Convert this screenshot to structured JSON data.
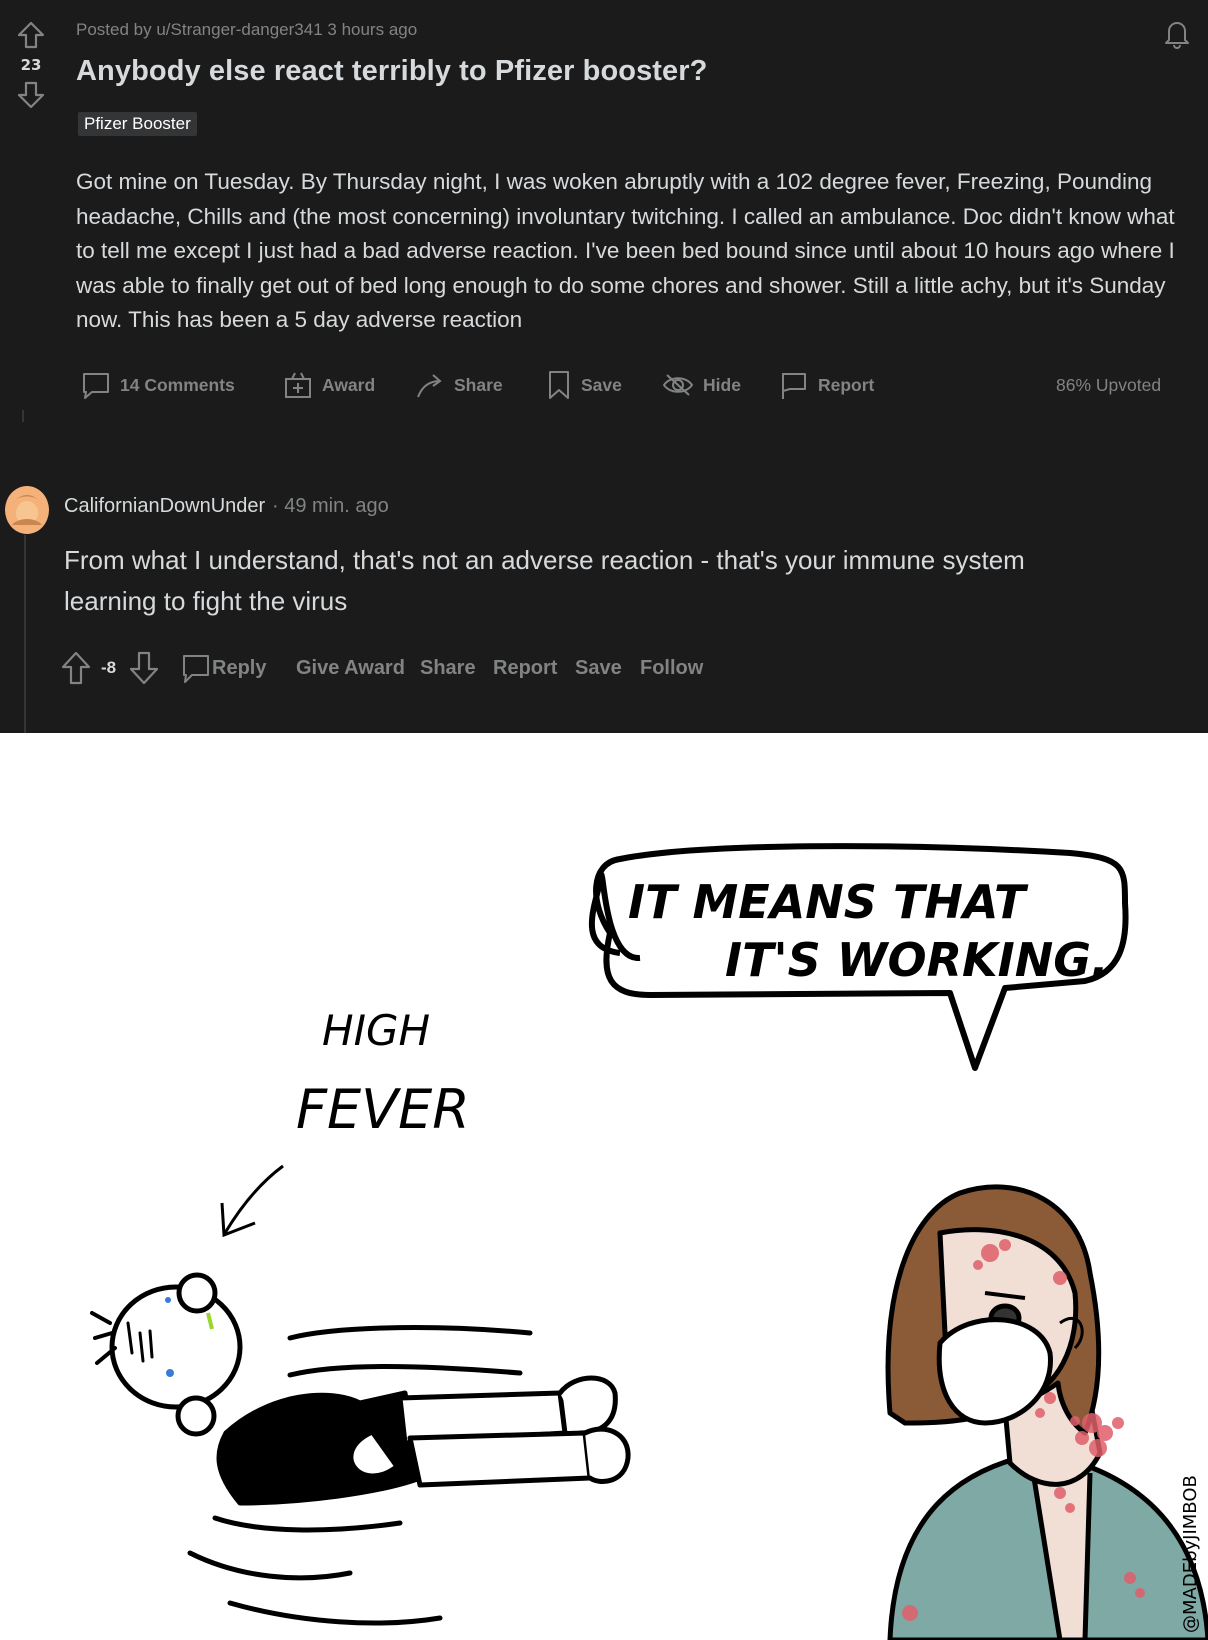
{
  "post": {
    "score": "23",
    "meta": "Posted by u/Stranger-danger341 3 hours ago",
    "title": "Anybody else react terribly to Pfizer booster?",
    "flair": "Pfizer Booster",
    "body": "Got mine on Tuesday. By Thursday night, I was woken abruptly with a 102 degree fever, Freezing, Pounding headache, Chills and (the most concerning) involuntary twitching. I called an ambulance. Doc didn't know what to tell me except I just had a bad adverse reaction. I've been bed bound since until about 10 hours ago where I was able to finally get out of bed long enough to do some chores and shower. Still a little achy, but it's Sunday now. This has been a 5 day adverse reaction",
    "actions": {
      "comments": "14 Comments",
      "award": "Award",
      "share": "Share",
      "save": "Save",
      "hide": "Hide",
      "report": "Report"
    },
    "upvoted": "86% Upvoted"
  },
  "comment": {
    "author": "CalifornianDownUnder",
    "time": "· 49 min. ago",
    "text": "From what I understand, that's not an adverse reaction - that's your immune system learning to fight the virus",
    "score": "-8",
    "actions": {
      "reply": "Reply",
      "give_award": "Give Award",
      "share": "Share",
      "report": "Report",
      "save": "Save",
      "follow": "Follow"
    }
  },
  "comic": {
    "speech_line1": "IT  MEANS  THAT",
    "speech_line2": "IT'S  WORKING.",
    "label_line1": "HIGH",
    "label_line2": "FEVER",
    "signature": "@MADEbyJIMBOB"
  },
  "colors": {
    "post_bg": "#1b1b1b",
    "text": "#d7dadc",
    "muted": "#818384",
    "scrubs": "#7fa9a5",
    "rash": "#e05f6b",
    "hair": "#8b5a36"
  }
}
